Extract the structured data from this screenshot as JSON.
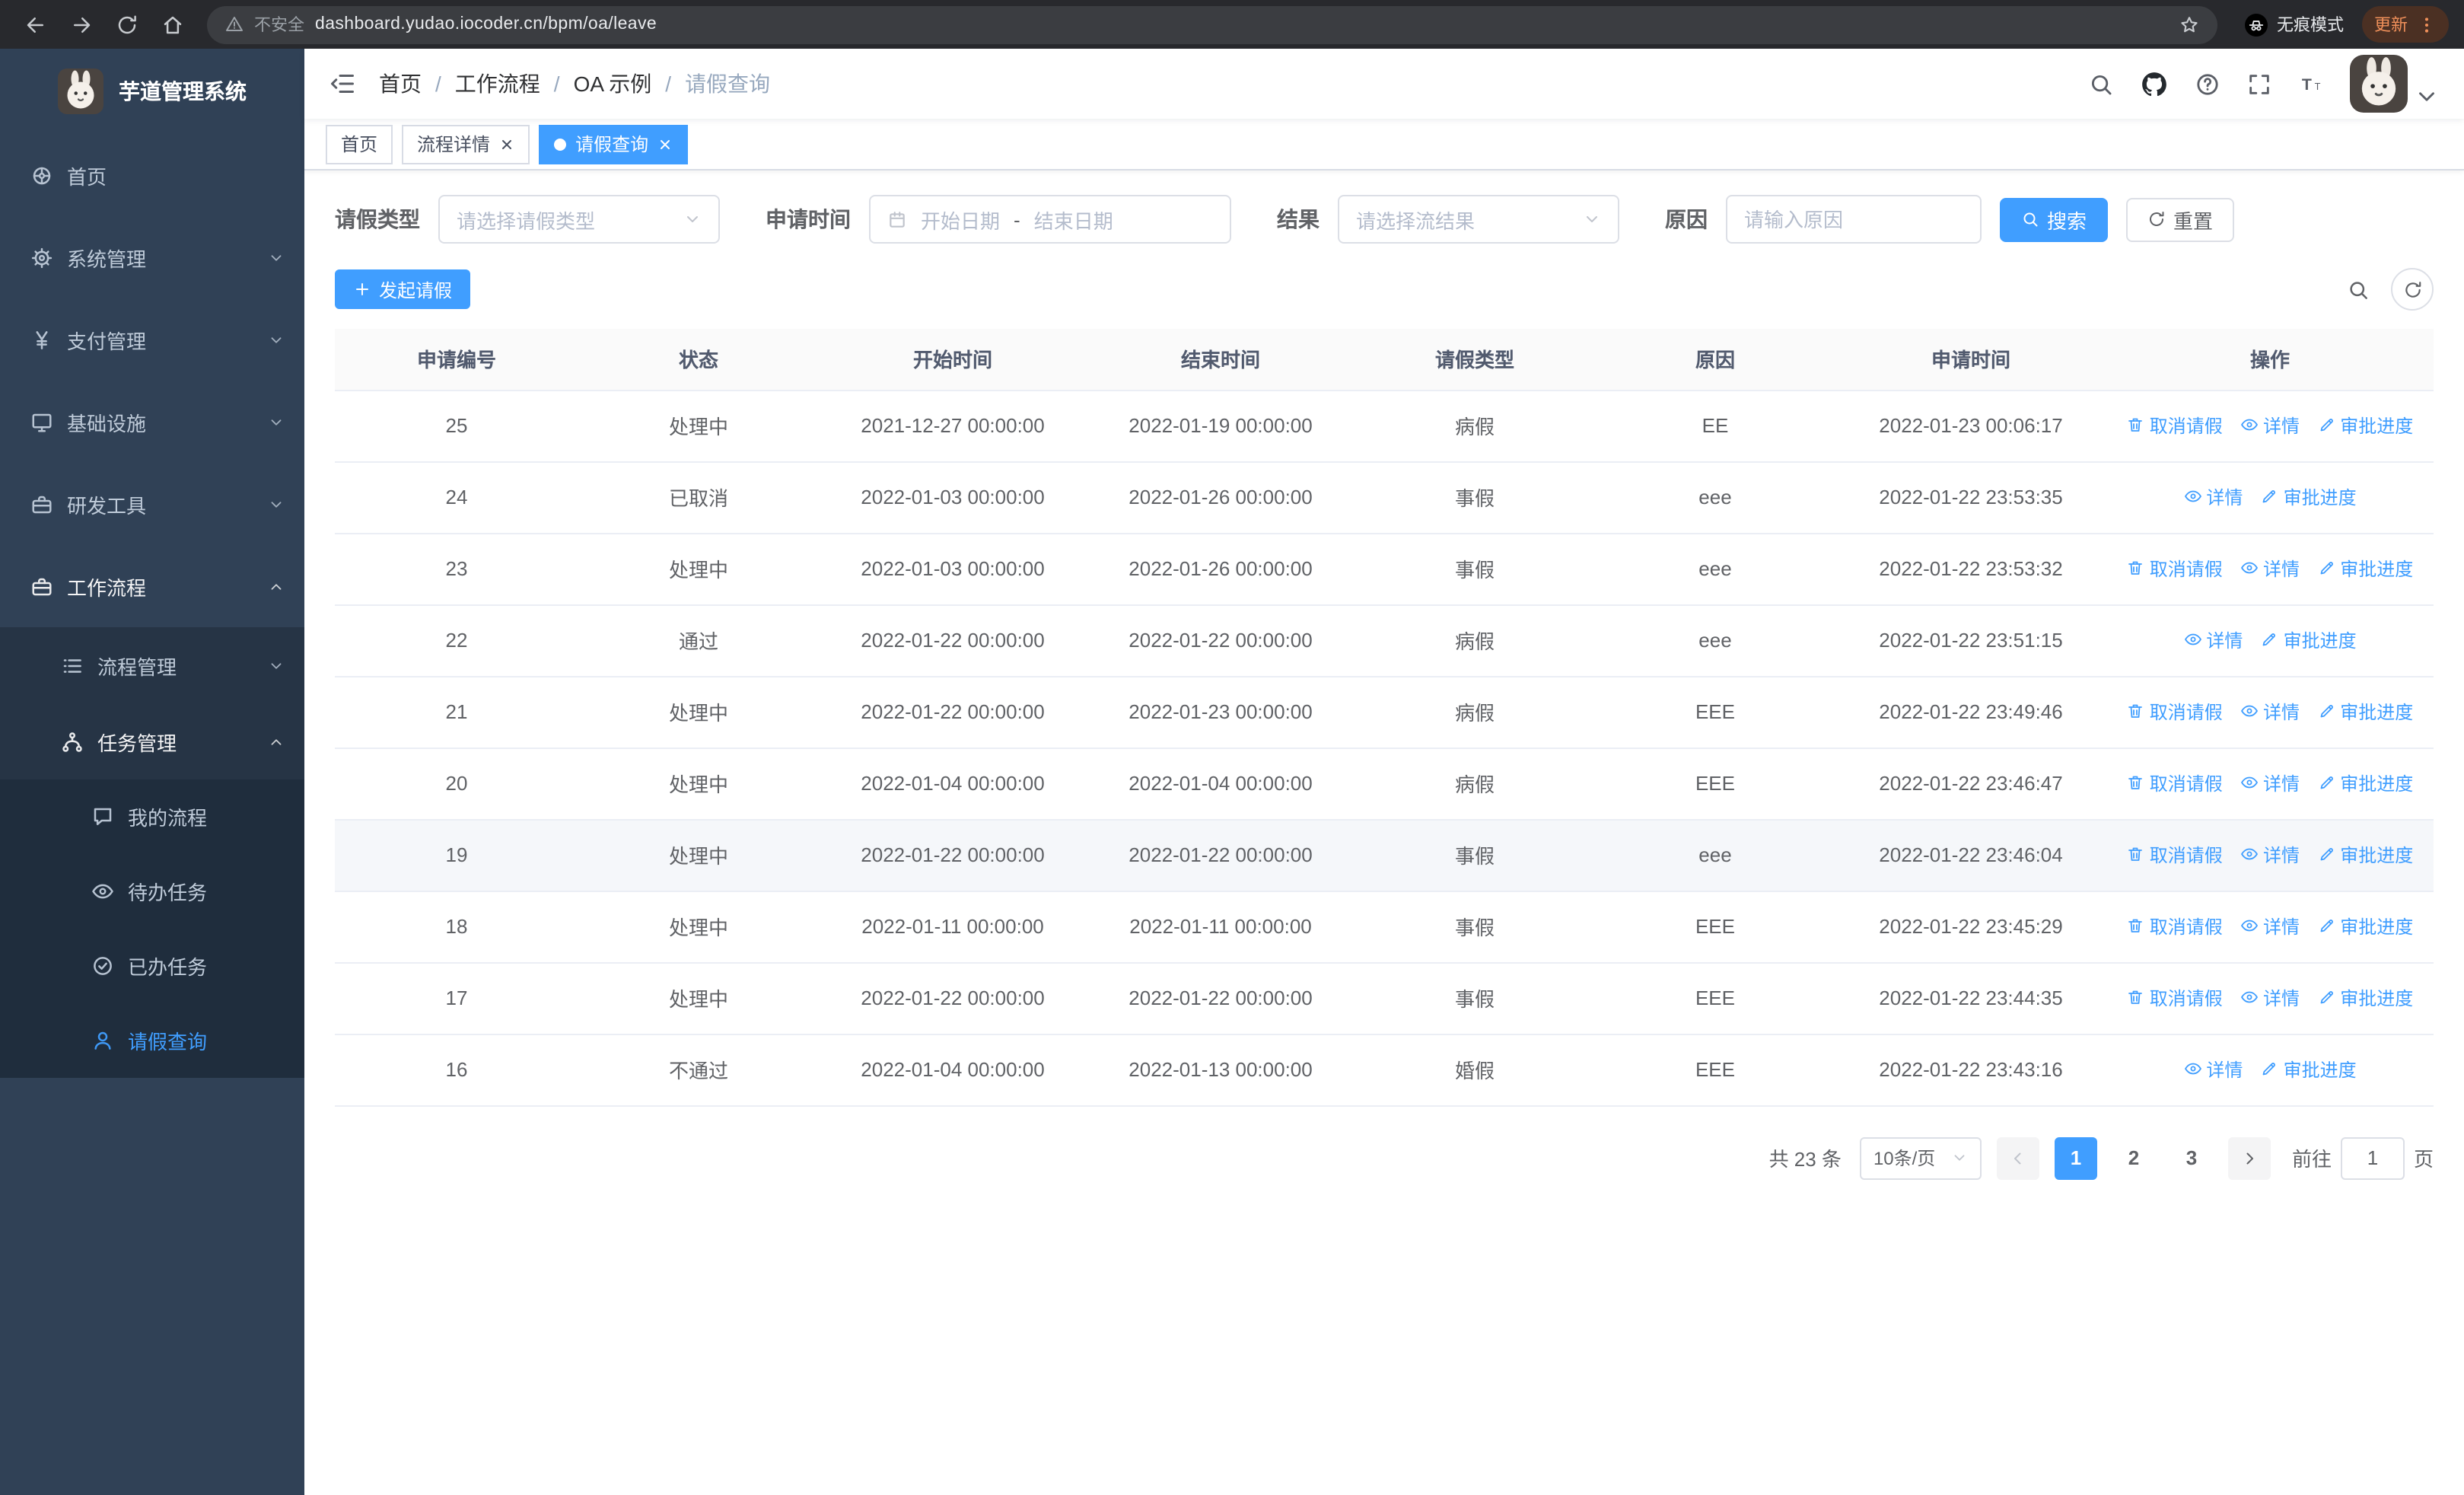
{
  "browser": {
    "security_label": "不安全",
    "url": "dashboard.yudao.iocoder.cn/bpm/oa/leave",
    "incognito_label": "无痕模式",
    "update_label": "更新"
  },
  "sidebar": {
    "logo_title": "芋道管理系统",
    "items": [
      {
        "label": "首页"
      },
      {
        "label": "系统管理"
      },
      {
        "label": "支付管理"
      },
      {
        "label": "基础设施"
      },
      {
        "label": "研发工具"
      },
      {
        "label": "工作流程"
      },
      {
        "label": "流程管理"
      },
      {
        "label": "任务管理"
      },
      {
        "label": "我的流程"
      },
      {
        "label": "待办任务"
      },
      {
        "label": "已办任务"
      },
      {
        "label": "请假查询"
      }
    ]
  },
  "breadcrumb": [
    "首页",
    "工作流程",
    "OA 示例",
    "请假查询"
  ],
  "breadcrumb_separator": "/",
  "tags": [
    {
      "label": "首页"
    },
    {
      "label": "流程详情"
    },
    {
      "label": "请假查询"
    }
  ],
  "filters": {
    "leave_type_label": "请假类型",
    "leave_type_placeholder": "请选择请假类型",
    "apply_time_label": "申请时间",
    "start_date_placeholder": "开始日期",
    "range_separator": "-",
    "end_date_placeholder": "结束日期",
    "result_label": "结果",
    "result_placeholder": "请选择流结果",
    "reason_label": "原因",
    "reason_placeholder": "请输入原因",
    "search_label": "搜索",
    "reset_label": "重置"
  },
  "toolbar": {
    "create_label": "发起请假"
  },
  "table": {
    "columns": [
      "申请编号",
      "状态",
      "开始时间",
      "结束时间",
      "请假类型",
      "原因",
      "申请时间",
      "操作"
    ],
    "actions": {
      "cancel": "取消请假",
      "detail": "详情",
      "progress": "审批进度"
    },
    "rows": [
      {
        "id": "25",
        "status": "处理中",
        "start": "2021-12-27 00:00:00",
        "end": "2022-01-19 00:00:00",
        "type": "病假",
        "reason": "EE",
        "apply_time": "2022-01-23 00:06:17",
        "cancelable": true
      },
      {
        "id": "24",
        "status": "已取消",
        "start": "2022-01-03 00:00:00",
        "end": "2022-01-26 00:00:00",
        "type": "事假",
        "reason": "eee",
        "apply_time": "2022-01-22 23:53:35",
        "cancelable": false
      },
      {
        "id": "23",
        "status": "处理中",
        "start": "2022-01-03 00:00:00",
        "end": "2022-01-26 00:00:00",
        "type": "事假",
        "reason": "eee",
        "apply_time": "2022-01-22 23:53:32",
        "cancelable": true
      },
      {
        "id": "22",
        "status": "通过",
        "start": "2022-01-22 00:00:00",
        "end": "2022-01-22 00:00:00",
        "type": "病假",
        "reason": "eee",
        "apply_time": "2022-01-22 23:51:15",
        "cancelable": false
      },
      {
        "id": "21",
        "status": "处理中",
        "start": "2022-01-22 00:00:00",
        "end": "2022-01-23 00:00:00",
        "type": "病假",
        "reason": "EEE",
        "apply_time": "2022-01-22 23:49:46",
        "cancelable": true
      },
      {
        "id": "20",
        "status": "处理中",
        "start": "2022-01-04 00:00:00",
        "end": "2022-01-04 00:00:00",
        "type": "病假",
        "reason": "EEE",
        "apply_time": "2022-01-22 23:46:47",
        "cancelable": true
      },
      {
        "id": "19",
        "status": "处理中",
        "start": "2022-01-22 00:00:00",
        "end": "2022-01-22 00:00:00",
        "type": "事假",
        "reason": "eee",
        "apply_time": "2022-01-22 23:46:04",
        "cancelable": true,
        "hovered": true
      },
      {
        "id": "18",
        "status": "处理中",
        "start": "2022-01-11 00:00:00",
        "end": "2022-01-11 00:00:00",
        "type": "事假",
        "reason": "EEE",
        "apply_time": "2022-01-22 23:45:29",
        "cancelable": true
      },
      {
        "id": "17",
        "status": "处理中",
        "start": "2022-01-22 00:00:00",
        "end": "2022-01-22 00:00:00",
        "type": "事假",
        "reason": "EEE",
        "apply_time": "2022-01-22 23:44:35",
        "cancelable": true
      },
      {
        "id": "16",
        "status": "不通过",
        "start": "2022-01-04 00:00:00",
        "end": "2022-01-13 00:00:00",
        "type": "婚假",
        "reason": "EEE",
        "apply_time": "2022-01-22 23:43:16",
        "cancelable": false
      }
    ]
  },
  "pagination": {
    "total_text": "共 23 条",
    "page_size": "10条/页",
    "pages": [
      "1",
      "2",
      "3"
    ],
    "goto_label": "前往",
    "goto_value": "1",
    "goto_suffix": "页"
  }
}
